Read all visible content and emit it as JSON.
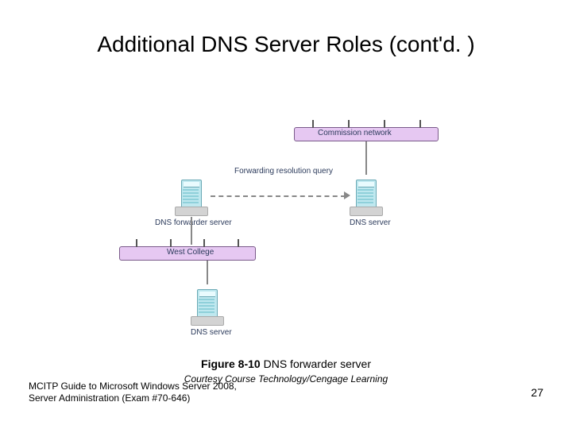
{
  "title": "Additional DNS Server Roles (cont'd. )",
  "diagram": {
    "commission_network": "Commission network",
    "west_college": "West College",
    "dns_forwarder_server": "DNS forwarder server",
    "dns_server_right": "DNS server",
    "dns_server_bottom": "DNS server",
    "forwarding_query": "Forwarding resolution query"
  },
  "caption": {
    "figure_label": "Figure 8-10 ",
    "figure_title": "DNS forwarder server",
    "courtesy": "Courtesy Course Technology/Cengage Learning"
  },
  "footer": {
    "left_line1": "MCITP Guide to Microsoft Windows Server 2008,",
    "left_line2": "Server Administration (Exam #70-646)",
    "page_number": "27"
  }
}
